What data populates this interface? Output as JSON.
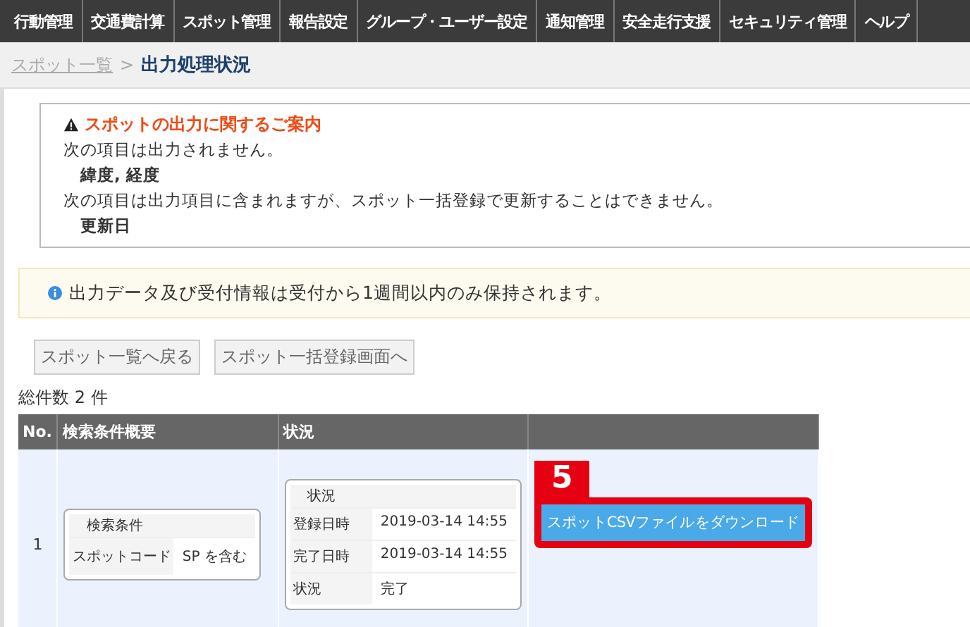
{
  "nav": {
    "items": [
      {
        "label": "行動管理"
      },
      {
        "label": "交通費計算"
      },
      {
        "label": "スポット管理"
      },
      {
        "label": "報告設定"
      },
      {
        "label": "グループ・ユーザー設定"
      },
      {
        "label": "通知管理"
      },
      {
        "label": "安全走行支援"
      },
      {
        "label": "セキュリティ管理"
      },
      {
        "label": "ヘルプ"
      }
    ]
  },
  "breadcrumb": {
    "link": "スポット一覧",
    "separator": ">",
    "current": "出力処理状況"
  },
  "notice": {
    "title": "スポットの出力に関するご案内",
    "lines": [
      {
        "kind": "text",
        "text": "次の項目は出力されません。"
      },
      {
        "kind": "item",
        "text": "緯度, 経度"
      },
      {
        "kind": "text",
        "text": "次の項目は出力項目に含まれますが、スポット一括登録で更新することはできません。"
      },
      {
        "kind": "item",
        "text": "更新日"
      }
    ]
  },
  "info": {
    "text": "出力データ及び受付情報は受付から1週間以内のみ保持されます。"
  },
  "buttons": [
    "スポット一覧へ戻る",
    "スポット一括登録画面へ"
  ],
  "total": "総件数 2 件",
  "table": {
    "columns": [
      "No.",
      "検索条件概要",
      "状況",
      ""
    ],
    "rows": [
      {
        "no": "1",
        "condition": {
          "title": "検索条件",
          "label": "スポットコード",
          "value": "SP を含む"
        },
        "status": {
          "title": "状況",
          "rows": [
            {
              "label": "登録日時",
              "value": "2019-03-14 14:55"
            },
            {
              "label": "完了日時",
              "value": "2019-03-14 14:55"
            },
            {
              "label": "状況",
              "value": "完了"
            }
          ]
        },
        "action": "スポットCSVファイルをダウンロード",
        "callout": "5"
      }
    ]
  }
}
